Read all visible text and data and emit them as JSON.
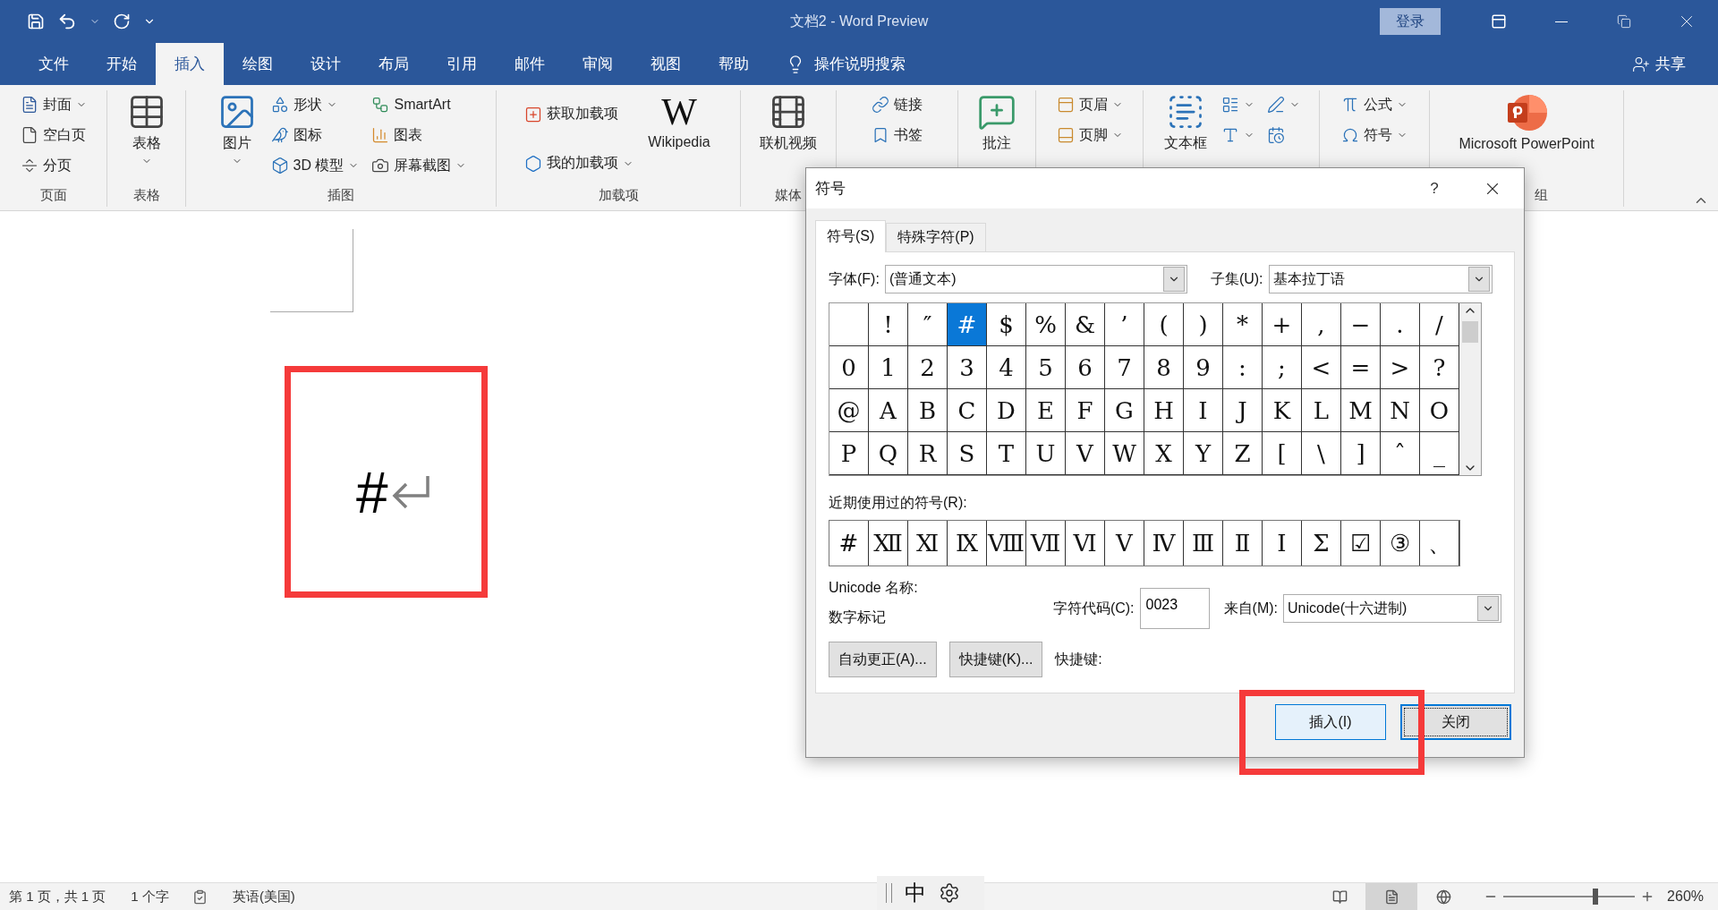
{
  "window": {
    "title": "文档2  -  Word Preview",
    "sign_in": "登录"
  },
  "tabs": [
    {
      "label": "文件",
      "selected": false
    },
    {
      "label": "开始",
      "selected": false
    },
    {
      "label": "插入",
      "selected": true
    },
    {
      "label": "绘图",
      "selected": false
    },
    {
      "label": "设计",
      "selected": false
    },
    {
      "label": "布局",
      "selected": false
    },
    {
      "label": "引用",
      "selected": false
    },
    {
      "label": "邮件",
      "selected": false
    },
    {
      "label": "审阅",
      "selected": false
    },
    {
      "label": "视图",
      "selected": false
    },
    {
      "label": "帮助",
      "selected": false
    }
  ],
  "tell_me": "操作说明搜索",
  "share": "共享",
  "ribbon": {
    "groups": [
      {
        "label": "页面",
        "columns": [
          [
            {
              "kind": "small",
              "label": "封面",
              "dropdown": true
            },
            {
              "kind": "small",
              "label": "空白页",
              "dropdown": false
            },
            {
              "kind": "small",
              "label": "分页",
              "dropdown": false
            }
          ]
        ]
      },
      {
        "label": "表格",
        "columns": [
          [
            {
              "kind": "large",
              "label": "表格",
              "dropdown": true
            }
          ]
        ]
      },
      {
        "label": "插图",
        "columns": [
          [
            {
              "kind": "large",
              "label": "图片",
              "dropdown": true
            }
          ],
          [
            {
              "kind": "small",
              "label": "形状",
              "dropdown": true
            },
            {
              "kind": "small",
              "label": "图标",
              "dropdown": false
            },
            {
              "kind": "small",
              "label": "3D 模型",
              "dropdown": true
            }
          ],
          [
            {
              "kind": "small",
              "label": "SmartArt",
              "dropdown": false
            },
            {
              "kind": "small",
              "label": "图表",
              "dropdown": false
            },
            {
              "kind": "small",
              "label": "屏幕截图",
              "dropdown": true
            }
          ]
        ]
      },
      {
        "label": "加载项",
        "columns": [
          [
            {
              "kind": "small",
              "label": "获取加载项",
              "dropdown": false
            },
            {
              "kind": "small",
              "label": "我的加载项",
              "dropdown": true
            }
          ],
          [
            {
              "kind": "logo",
              "logo": "W",
              "label": "Wikipedia",
              "dropdown": false
            }
          ]
        ]
      },
      {
        "label": "媒体",
        "columns": [
          [
            {
              "kind": "large",
              "label": "联机视频",
              "dropdown": false
            }
          ]
        ]
      },
      {
        "columns": [
          [
            {
              "kind": "small",
              "label": "链接",
              "dropdown": false
            },
            {
              "kind": "small",
              "label": "书签",
              "dropdown": false
            }
          ]
        ]
      },
      {
        "columns": [
          [
            {
              "kind": "large",
              "label": "批注",
              "dropdown": false
            }
          ]
        ]
      },
      {
        "columns": [
          [
            {
              "kind": "small",
              "label": "页眉",
              "dropdown": true
            },
            {
              "kind": "small",
              "label": "页脚",
              "dropdown": true
            }
          ]
        ]
      },
      {
        "columns": [
          [
            {
              "kind": "large",
              "label": "文本框",
              "dropdown": false
            }
          ],
          [
            {
              "kind": "small",
              "dropdown": true
            },
            {
              "kind": "small",
              "dropdown": true
            }
          ],
          [
            {
              "kind": "small",
              "dropdown": true
            },
            {
              "kind": "small",
              "dropdown": false
            }
          ]
        ]
      },
      {
        "columns": [
          [
            {
              "kind": "small",
              "label": "公式",
              "dropdown": true
            },
            {
              "kind": "small",
              "label": "符号",
              "dropdown": true
            }
          ]
        ]
      },
      {
        "label": "组",
        "columns": [
          [
            {
              "kind": "large",
              "label": "Microsoft PowerPoint",
              "dropdown": false
            }
          ]
        ]
      }
    ]
  },
  "document": {
    "text": "#"
  },
  "dialog": {
    "title": "符号",
    "help": "?",
    "tabs": [
      {
        "label": "符号(S)",
        "selected": true
      },
      {
        "label": "特殊字符(P)",
        "selected": false
      }
    ],
    "font_label": "字体(F):",
    "font_value": "(普通文本)",
    "subset_label": "子集(U):",
    "subset_value": "基本拉丁语",
    "symbols": [
      [
        {
          "selected": false
        },
        {
          "char": "!",
          "selected": false
        },
        {
          "char": "″",
          "selected": false
        },
        {
          "char": "#",
          "selected": true
        },
        {
          "char": "$",
          "selected": false
        },
        {
          "char": "%",
          "selected": false
        },
        {
          "char": "&",
          "selected": false
        },
        {
          "char": "’",
          "selected": false
        },
        {
          "char": "(",
          "selected": false
        },
        {
          "char": ")",
          "selected": false
        },
        {
          "char": "*",
          "selected": false
        },
        {
          "char": "+",
          "selected": false
        },
        {
          "char": ",",
          "selected": false
        },
        {
          "char": "−",
          "selected": false
        },
        {
          "char": ".",
          "selected": false
        },
        {
          "char": "/",
          "selected": false
        }
      ],
      [
        {
          "char": "0",
          "selected": false
        },
        {
          "char": "1",
          "selected": false
        },
        {
          "char": "2",
          "selected": false
        },
        {
          "char": "3",
          "selected": false
        },
        {
          "char": "4",
          "selected": false
        },
        {
          "char": "5",
          "selected": false
        },
        {
          "char": "6",
          "selected": false
        },
        {
          "char": "7",
          "selected": false
        },
        {
          "char": "8",
          "selected": false
        },
        {
          "char": "9",
          "selected": false
        },
        {
          "char": ":",
          "selected": false
        },
        {
          "char": ";",
          "selected": false
        },
        {
          "char": "<",
          "selected": false
        },
        {
          "char": "=",
          "selected": false
        },
        {
          "char": ">",
          "selected": false
        },
        {
          "char": "?",
          "selected": false
        }
      ],
      [
        {
          "char": "@",
          "selected": false
        },
        {
          "char": "A",
          "selected": false
        },
        {
          "char": "B",
          "selected": false
        },
        {
          "char": "C",
          "selected": false
        },
        {
          "char": "D",
          "selected": false
        },
        {
          "char": "E",
          "selected": false
        },
        {
          "char": "F",
          "selected": false
        },
        {
          "char": "G",
          "selected": false
        },
        {
          "char": "H",
          "selected": false
        },
        {
          "char": "I",
          "selected": false
        },
        {
          "char": "J",
          "selected": false
        },
        {
          "char": "K",
          "selected": false
        },
        {
          "char": "L",
          "selected": false
        },
        {
          "char": "M",
          "selected": false
        },
        {
          "char": "N",
          "selected": false
        },
        {
          "char": "O",
          "selected": false
        }
      ],
      [
        {
          "char": "P",
          "selected": false
        },
        {
          "char": "Q",
          "selected": false
        },
        {
          "char": "R",
          "selected": false
        },
        {
          "char": "S",
          "selected": false
        },
        {
          "char": "T",
          "selected": false
        },
        {
          "char": "U",
          "selected": false
        },
        {
          "char": "V",
          "selected": false
        },
        {
          "char": "W",
          "selected": false
        },
        {
          "char": "X",
          "selected": false
        },
        {
          "char": "Y",
          "selected": false
        },
        {
          "char": "Z",
          "selected": false
        },
        {
          "char": "[",
          "selected": false
        },
        {
          "char": "\\",
          "selected": false
        },
        {
          "char": "]",
          "selected": false
        },
        {
          "char": "ˆ",
          "selected": false
        },
        {
          "char": "_",
          "selected": false
        }
      ]
    ],
    "recent_label": "近期使用过的符号(R):",
    "recent": [
      "#",
      "Ⅻ",
      "Ⅺ",
      "Ⅸ",
      "Ⅷ",
      "Ⅶ",
      "Ⅵ",
      "Ⅴ",
      "Ⅳ",
      "Ⅲ",
      "Ⅱ",
      "Ⅰ",
      "Σ",
      "☑",
      "③",
      "、"
    ],
    "unicode_name_label": "Unicode 名称:",
    "unicode_name": "数字标记",
    "code_label": "字符代码(C):",
    "code_value": "0023",
    "from_label": "来自(M):",
    "from_value": "Unicode(十六进制)",
    "buttons": [
      "自动更正(A)...",
      "快捷键(K)..."
    ],
    "shortcut_label": "快捷键:",
    "footer_buttons": [
      {
        "label": "插入(I)",
        "hovered": true,
        "focused": false
      },
      {
        "label": "关闭",
        "hovered": false,
        "focused": true
      }
    ]
  },
  "status_bar": {
    "page": "第 1 页，共 1 页",
    "words": "1 个字",
    "language": "英语(美国)",
    "ime": "中",
    "views": [
      {
        "kind": "read",
        "selected": false
      },
      {
        "kind": "print",
        "selected": true
      },
      {
        "kind": "web",
        "selected": false
      }
    ],
    "zoom": {
      "level": 0.7
    },
    "zoom_text": "260%"
  }
}
